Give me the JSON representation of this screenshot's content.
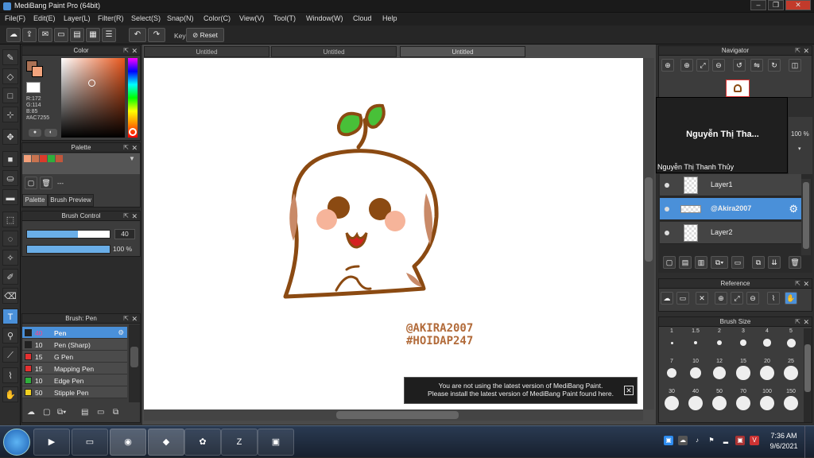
{
  "app": {
    "title": "MediBang Paint Pro (64bit)"
  },
  "menu": [
    "File(F)",
    "Edit(E)",
    "Layer(L)",
    "Filter(R)",
    "Select(S)",
    "Snap(N)",
    "Color(C)",
    "View(V)",
    "Tool(T)",
    "Window(W)",
    "Cloud",
    "Help"
  ],
  "toolbar": {
    "key_label": "Key",
    "reset_label": "Reset"
  },
  "doc_tabs": [
    "Untitled",
    "Untitled",
    "Untitled"
  ],
  "color_panel": {
    "title": "Color",
    "r": "R:172",
    "g": "G:114",
    "b": "B:85",
    "hex": "#AC7255",
    "fg": "#AC7255",
    "bg": "#ffffff"
  },
  "palette_panel": {
    "title": "Palette",
    "tab_palette": "Palette",
    "tab_preview": "Brush Preview",
    "swatches": [
      "#f4a07a",
      "#c8734f",
      "#d93b2b",
      "#2fae3c",
      "#c1563b"
    ],
    "dash": "---"
  },
  "brush_control": {
    "title": "Brush Control",
    "size": "40",
    "opacity": "100 %",
    "size_fill": 0.62,
    "opacity_fill": 1.0
  },
  "brush_list": {
    "title": "Brush: Pen",
    "items": [
      {
        "size": "40",
        "name": "Pen",
        "color": "#222222",
        "active": true
      },
      {
        "size": "10",
        "name": "Pen (Sharp)",
        "color": "#222222"
      },
      {
        "size": "15",
        "name": "G Pen",
        "color": "#e53030"
      },
      {
        "size": "15",
        "name": "Mapping Pen",
        "color": "#e53030"
      },
      {
        "size": "10",
        "name": "Edge Pen",
        "color": "#2fae3c"
      },
      {
        "size": "50",
        "name": "Stipple Pen",
        "color": "#f0d020"
      }
    ]
  },
  "canvas": {
    "watermark_line1": "@AKIRA2007",
    "watermark_line2": "#HOIDAP247"
  },
  "notice": {
    "line1": "You are not using the latest version of MediBang Paint.",
    "line2": "Please install the latest version of MediBang Paint found here."
  },
  "navigator": {
    "title": "Navigator"
  },
  "popup": {
    "title": "Nguyễn Thị Tha...",
    "full_name": "Nguyễn Thị Thanh Thủy"
  },
  "layers_panel": {
    "opacity": "100 %",
    "items": [
      {
        "name": "Layer1"
      },
      {
        "name": "@Akira2007",
        "active": true
      },
      {
        "name": "Layer2"
      }
    ]
  },
  "reference": {
    "title": "Reference"
  },
  "brush_size": {
    "title": "Brush Size",
    "sizes": [
      "1",
      "1.5",
      "2",
      "3",
      "4",
      "5",
      "7",
      "10",
      "12",
      "15",
      "20",
      "25",
      "30",
      "40",
      "50",
      "70",
      "100",
      "150"
    ]
  },
  "taskbar": {
    "time": "7:36 AM",
    "date": "9/6/2021",
    "apps": [
      "start",
      "media",
      "explorer",
      "chrome",
      "medibang",
      "app",
      "zalo",
      "zoom"
    ]
  }
}
